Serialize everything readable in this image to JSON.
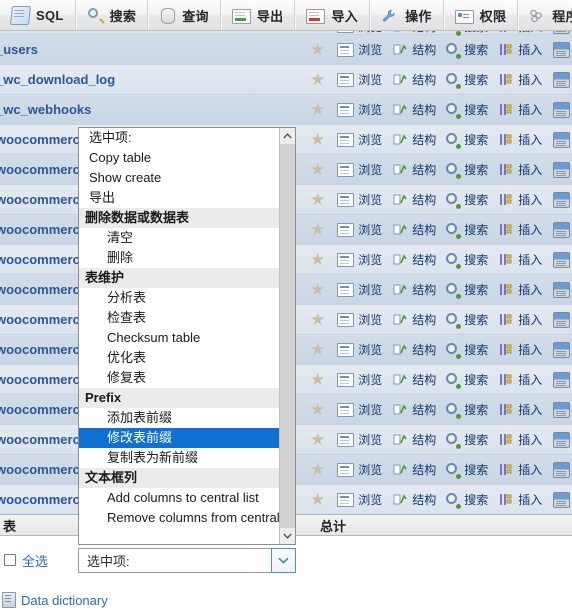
{
  "toolbar": {
    "items": [
      {
        "label": "SQL",
        "icon": "sql-icon"
      },
      {
        "label": "搜索",
        "icon": "search-icon"
      },
      {
        "label": "查询",
        "icon": "database-icon"
      },
      {
        "label": "导出",
        "icon": "export-icon"
      },
      {
        "label": "导入",
        "icon": "import-icon"
      },
      {
        "label": "操作",
        "icon": "wrench-icon"
      },
      {
        "label": "权限",
        "icon": "permissions-icon"
      },
      {
        "label": "程序",
        "icon": "routines-icon"
      }
    ]
  },
  "row_actions": {
    "star": "★",
    "browse": "浏览",
    "structure": "结构",
    "search": "搜索",
    "insert": "插入",
    "empty": ""
  },
  "table_rows": [
    {
      "name": "",
      "partial_top": true
    },
    {
      "name": "_users"
    },
    {
      "name": "_wc_download_log"
    },
    {
      "name": "_wc_webhooks"
    },
    {
      "name": "woocommerce"
    },
    {
      "name": "woocommerce"
    },
    {
      "name": "woocommerce"
    },
    {
      "name": "woocommerce_sessions"
    },
    {
      "name": "woocommerce"
    },
    {
      "name": "woocommerce"
    },
    {
      "name": "woocommerce"
    },
    {
      "name": "woocommerce"
    },
    {
      "name": "woocommerce"
    },
    {
      "name": "woocommerce"
    },
    {
      "name": "woocommerce"
    },
    {
      "name": "woocommerce"
    },
    {
      "name": "woocommerce"
    },
    {
      "name": "woocommerce"
    },
    {
      "name": "woocommerce"
    },
    {
      "name": "woocommerce"
    }
  ],
  "dropdown": {
    "items": [
      {
        "label": "选中项:",
        "type": "item"
      },
      {
        "label": "Copy table",
        "type": "item"
      },
      {
        "label": "Show create",
        "type": "item"
      },
      {
        "label": "导出",
        "type": "item"
      },
      {
        "label": "删除数据或数据表",
        "type": "group"
      },
      {
        "label": "清空",
        "type": "sub"
      },
      {
        "label": "删除",
        "type": "sub"
      },
      {
        "label": "表维护",
        "type": "group"
      },
      {
        "label": "分析表",
        "type": "sub"
      },
      {
        "label": "检查表",
        "type": "sub"
      },
      {
        "label": "Checksum table",
        "type": "sub"
      },
      {
        "label": "优化表",
        "type": "sub"
      },
      {
        "label": "修复表",
        "type": "sub"
      },
      {
        "label": "Prefix",
        "type": "group"
      },
      {
        "label": "添加表前缀",
        "type": "sub"
      },
      {
        "label": "修改表前缀",
        "type": "sub",
        "selected": true
      },
      {
        "label": "复制表为新前缀",
        "type": "sub"
      },
      {
        "label": "文本框列",
        "type": "group"
      },
      {
        "label": "Add columns to central list",
        "type": "sub"
      },
      {
        "label": "Remove columns from central list",
        "type": "sub"
      }
    ]
  },
  "footer": {
    "tables_header": "表",
    "total_header": "总计",
    "select_all": "全选",
    "with_selected_value": "选中项:",
    "data_dictionary": "Data dictionary"
  },
  "colors": {
    "link": "#2a6ebb",
    "table_name": "#2b5797",
    "highlight": "#0f70d1",
    "row_odd": "#e4eaf1",
    "row_even": "#d3dde9",
    "group_header_bg": "#ebebeb"
  }
}
